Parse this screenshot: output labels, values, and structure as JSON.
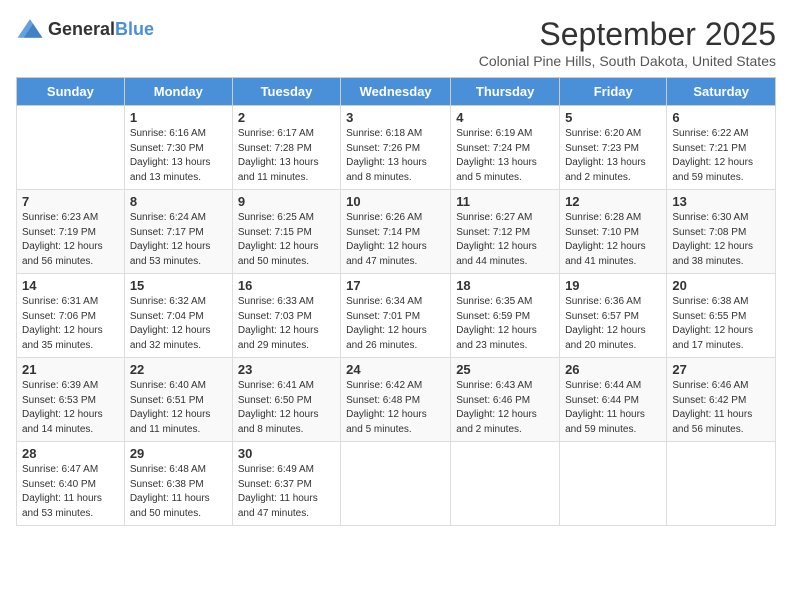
{
  "header": {
    "logo_general": "General",
    "logo_blue": "Blue",
    "month_title": "September 2025",
    "location": "Colonial Pine Hills, South Dakota, United States"
  },
  "days_of_week": [
    "Sunday",
    "Monday",
    "Tuesday",
    "Wednesday",
    "Thursday",
    "Friday",
    "Saturday"
  ],
  "weeks": [
    [
      {
        "day": "",
        "info": ""
      },
      {
        "day": "1",
        "info": "Sunrise: 6:16 AM\nSunset: 7:30 PM\nDaylight: 13 hours\nand 13 minutes."
      },
      {
        "day": "2",
        "info": "Sunrise: 6:17 AM\nSunset: 7:28 PM\nDaylight: 13 hours\nand 11 minutes."
      },
      {
        "day": "3",
        "info": "Sunrise: 6:18 AM\nSunset: 7:26 PM\nDaylight: 13 hours\nand 8 minutes."
      },
      {
        "day": "4",
        "info": "Sunrise: 6:19 AM\nSunset: 7:24 PM\nDaylight: 13 hours\nand 5 minutes."
      },
      {
        "day": "5",
        "info": "Sunrise: 6:20 AM\nSunset: 7:23 PM\nDaylight: 13 hours\nand 2 minutes."
      },
      {
        "day": "6",
        "info": "Sunrise: 6:22 AM\nSunset: 7:21 PM\nDaylight: 12 hours\nand 59 minutes."
      }
    ],
    [
      {
        "day": "7",
        "info": "Sunrise: 6:23 AM\nSunset: 7:19 PM\nDaylight: 12 hours\nand 56 minutes."
      },
      {
        "day": "8",
        "info": "Sunrise: 6:24 AM\nSunset: 7:17 PM\nDaylight: 12 hours\nand 53 minutes."
      },
      {
        "day": "9",
        "info": "Sunrise: 6:25 AM\nSunset: 7:15 PM\nDaylight: 12 hours\nand 50 minutes."
      },
      {
        "day": "10",
        "info": "Sunrise: 6:26 AM\nSunset: 7:14 PM\nDaylight: 12 hours\nand 47 minutes."
      },
      {
        "day": "11",
        "info": "Sunrise: 6:27 AM\nSunset: 7:12 PM\nDaylight: 12 hours\nand 44 minutes."
      },
      {
        "day": "12",
        "info": "Sunrise: 6:28 AM\nSunset: 7:10 PM\nDaylight: 12 hours\nand 41 minutes."
      },
      {
        "day": "13",
        "info": "Sunrise: 6:30 AM\nSunset: 7:08 PM\nDaylight: 12 hours\nand 38 minutes."
      }
    ],
    [
      {
        "day": "14",
        "info": "Sunrise: 6:31 AM\nSunset: 7:06 PM\nDaylight: 12 hours\nand 35 minutes."
      },
      {
        "day": "15",
        "info": "Sunrise: 6:32 AM\nSunset: 7:04 PM\nDaylight: 12 hours\nand 32 minutes."
      },
      {
        "day": "16",
        "info": "Sunrise: 6:33 AM\nSunset: 7:03 PM\nDaylight: 12 hours\nand 29 minutes."
      },
      {
        "day": "17",
        "info": "Sunrise: 6:34 AM\nSunset: 7:01 PM\nDaylight: 12 hours\nand 26 minutes."
      },
      {
        "day": "18",
        "info": "Sunrise: 6:35 AM\nSunset: 6:59 PM\nDaylight: 12 hours\nand 23 minutes."
      },
      {
        "day": "19",
        "info": "Sunrise: 6:36 AM\nSunset: 6:57 PM\nDaylight: 12 hours\nand 20 minutes."
      },
      {
        "day": "20",
        "info": "Sunrise: 6:38 AM\nSunset: 6:55 PM\nDaylight: 12 hours\nand 17 minutes."
      }
    ],
    [
      {
        "day": "21",
        "info": "Sunrise: 6:39 AM\nSunset: 6:53 PM\nDaylight: 12 hours\nand 14 minutes."
      },
      {
        "day": "22",
        "info": "Sunrise: 6:40 AM\nSunset: 6:51 PM\nDaylight: 12 hours\nand 11 minutes."
      },
      {
        "day": "23",
        "info": "Sunrise: 6:41 AM\nSunset: 6:50 PM\nDaylight: 12 hours\nand 8 minutes."
      },
      {
        "day": "24",
        "info": "Sunrise: 6:42 AM\nSunset: 6:48 PM\nDaylight: 12 hours\nand 5 minutes."
      },
      {
        "day": "25",
        "info": "Sunrise: 6:43 AM\nSunset: 6:46 PM\nDaylight: 12 hours\nand 2 minutes."
      },
      {
        "day": "26",
        "info": "Sunrise: 6:44 AM\nSunset: 6:44 PM\nDaylight: 11 hours\nand 59 minutes."
      },
      {
        "day": "27",
        "info": "Sunrise: 6:46 AM\nSunset: 6:42 PM\nDaylight: 11 hours\nand 56 minutes."
      }
    ],
    [
      {
        "day": "28",
        "info": "Sunrise: 6:47 AM\nSunset: 6:40 PM\nDaylight: 11 hours\nand 53 minutes."
      },
      {
        "day": "29",
        "info": "Sunrise: 6:48 AM\nSunset: 6:38 PM\nDaylight: 11 hours\nand 50 minutes."
      },
      {
        "day": "30",
        "info": "Sunrise: 6:49 AM\nSunset: 6:37 PM\nDaylight: 11 hours\nand 47 minutes."
      },
      {
        "day": "",
        "info": ""
      },
      {
        "day": "",
        "info": ""
      },
      {
        "day": "",
        "info": ""
      },
      {
        "day": "",
        "info": ""
      }
    ]
  ]
}
